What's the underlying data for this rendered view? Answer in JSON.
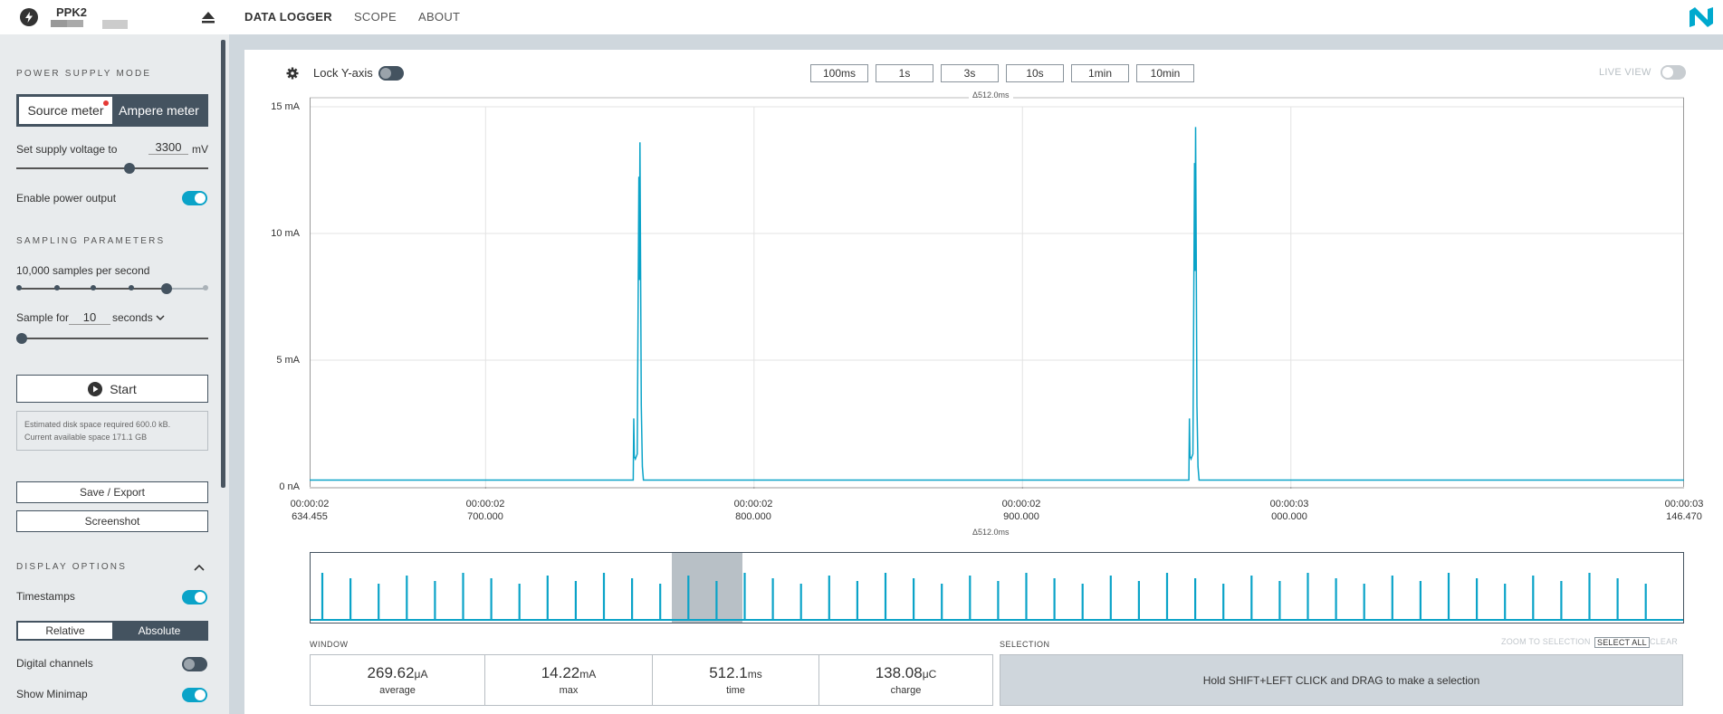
{
  "header": {
    "device_name": "PPK2",
    "nav": [
      "DATA LOGGER",
      "SCOPE",
      "ABOUT"
    ],
    "active_tab": "DATA LOGGER"
  },
  "sidebar": {
    "power_supply_mode_title": "POWER SUPPLY MODE",
    "mode_options": [
      "Source meter",
      "Ampere meter"
    ],
    "mode_selected": "Source meter",
    "supply_voltage_label": "Set supply voltage to",
    "supply_voltage_value": "3300",
    "supply_voltage_unit": "mV",
    "power_output_label": "Enable power output",
    "power_output_enabled": true,
    "sampling_title": "SAMPLING PARAMETERS",
    "samples_per_second_label": "10,000 samples per second",
    "sample_for_label": "Sample for",
    "sample_for_value": "10",
    "sample_for_unit": "seconds",
    "start_label": "Start",
    "disk_info_line1": "Estimated disk space required 600.0 kB.",
    "disk_info_line2": "Current available space 171.1 GB",
    "save_export_label": "Save / Export",
    "screenshot_label": "Screenshot",
    "display_options_title": "DISPLAY OPTIONS",
    "timestamps_label": "Timestamps",
    "timestamps_enabled": true,
    "timestamp_modes": [
      "Relative",
      "Absolute"
    ],
    "timestamp_mode_selected": "Relative",
    "digital_channels_label": "Digital channels",
    "digital_channels_enabled": false,
    "show_minimap_label": "Show Minimap",
    "show_minimap_enabled": true
  },
  "toolbar": {
    "lock_y_axis_label": "Lock Y-axis",
    "lock_y_axis_enabled": false,
    "window_buttons": [
      "100ms",
      "1s",
      "3s",
      "10s",
      "1min",
      "10min"
    ],
    "live_view_label": "LIVE VIEW",
    "live_view_enabled": false
  },
  "chart_data": {
    "type": "line",
    "xlabel": "",
    "ylabel": "",
    "y_ticks": [
      "15 mA",
      "10 mA",
      "5 mA",
      "0 nA"
    ],
    "ylim": [
      0,
      15
    ],
    "x_ticks": [
      {
        "time": "00:00:02",
        "ms": "634.455"
      },
      {
        "time": "00:00:02",
        "ms": "700.000"
      },
      {
        "time": "00:00:02",
        "ms": "800.000"
      },
      {
        "time": "00:00:02",
        "ms": "900.000"
      },
      {
        "time": "00:00:03",
        "ms": "000.000"
      },
      {
        "time": "00:00:03",
        "ms": "146.470"
      }
    ],
    "x_range_ms": [
      2634.455,
      3146.47
    ],
    "window_delta": "Δ512.0ms",
    "minimap_delta": "Δ512.0ms",
    "baseline_mA": 0.27,
    "pulses": [
      {
        "t_ms": 2757.5,
        "pre_peak_mA": 2.7,
        "peak_mA": 13.6
      },
      {
        "t_ms": 2964.5,
        "pre_peak_mA": 2.7,
        "peak_mA": 14.2
      }
    ],
    "line_color": "#0aa3c8",
    "grid": true
  },
  "stats": {
    "window_label": "WINDOW",
    "average_value": "269.62",
    "average_unit": "μA",
    "average_caption": "average",
    "max_value": "14.22",
    "max_unit": "mA",
    "max_caption": "max",
    "time_value": "512.1",
    "time_unit": "ms",
    "time_caption": "time",
    "charge_value": "138.08",
    "charge_unit": "μC",
    "charge_caption": "charge",
    "selection_label": "SELECTION",
    "zoom_to_selection_label": "ZOOM TO SELECTION",
    "select_all_label": "SELECT ALL",
    "clear_label": "CLEAR",
    "selection_hint": "Hold SHIFT+LEFT CLICK and DRAG to make a selection"
  },
  "colors": {
    "accent": "#0aa3c8",
    "dark": "#445360",
    "sidebar_bg": "#e8ebed"
  }
}
